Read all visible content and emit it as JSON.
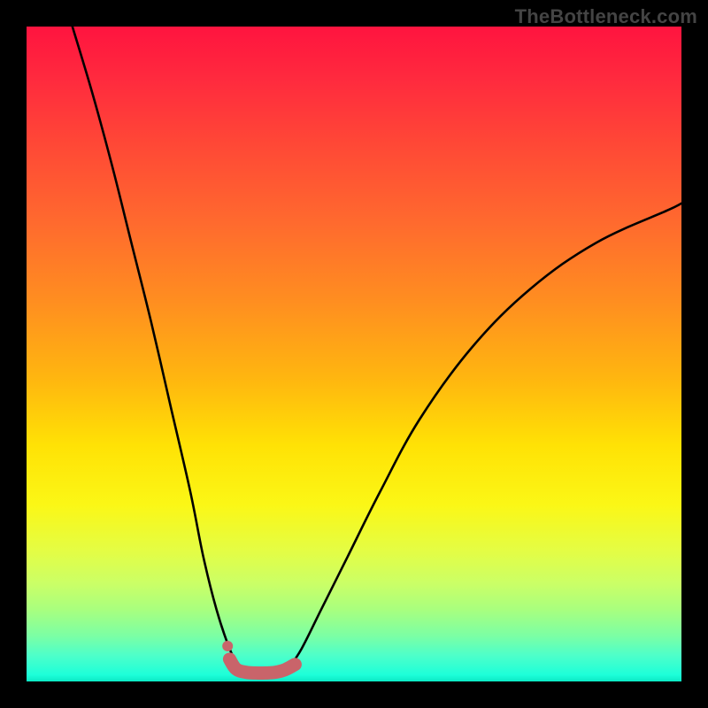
{
  "watermark": "TheBottleneck.com",
  "colors": {
    "background": "#000000",
    "curve": "#000000",
    "marker": "#c9646a",
    "watermark": "#444444"
  },
  "chart_data": {
    "type": "line",
    "title": "",
    "xlabel": "",
    "ylabel": "",
    "xlim": [
      0,
      100
    ],
    "ylim": [
      0,
      100
    ],
    "grid": false,
    "legend": false,
    "series": [
      {
        "name": "left-arm",
        "x": [
          7,
          10,
          13,
          16,
          19,
          22,
          25,
          27,
          29,
          31,
          32.5
        ],
        "y": [
          100,
          90,
          79,
          67,
          55,
          42,
          29,
          19,
          11,
          5,
          2
        ]
      },
      {
        "name": "right-arm",
        "x": [
          40,
          42,
          45,
          49,
          54,
          60,
          68,
          77,
          87,
          98,
          100
        ],
        "y": [
          2,
          5,
          11,
          19,
          29,
          40,
          51,
          60,
          67,
          72,
          73
        ]
      },
      {
        "name": "valley-floor-marker",
        "marker_only": true,
        "x": [
          31,
          32,
          33.5,
          35,
          36.5,
          38,
          39.5,
          41
        ],
        "y": [
          3.4,
          1.9,
          1.4,
          1.3,
          1.3,
          1.4,
          1.8,
          2.6
        ]
      }
    ],
    "annotations": []
  }
}
